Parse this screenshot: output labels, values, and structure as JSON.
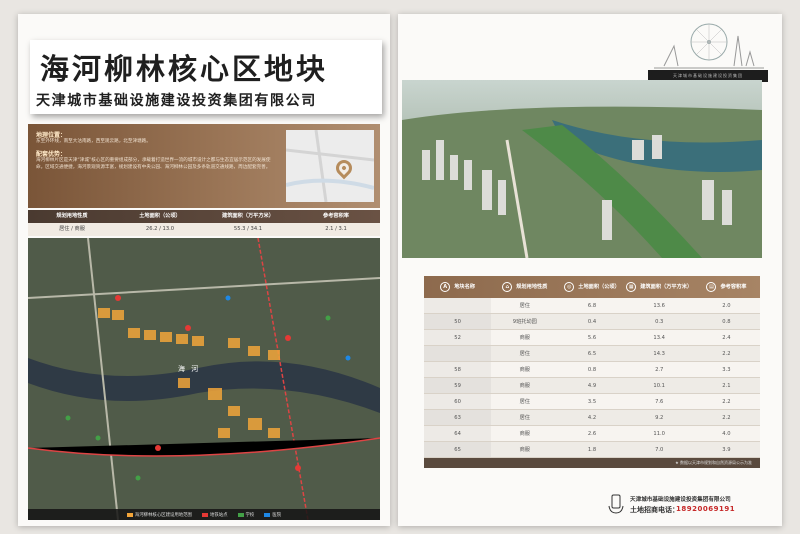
{
  "title": {
    "main": "海河柳林核心区地块",
    "sub": "天津城市基础设施建设投资集团有限公司"
  },
  "info": {
    "location_label": "地理位置：",
    "location_text": "东至外环线，南至大沽南路，西至观云路，北至津塘路。",
    "advantage_label": "配套优势：",
    "advantage_text": "海河柳林片区是天津“津城”核心区的重要组成部分，承载着打造世界一流的城市设计之都与生态宜居示范区的发展使命。区域交通便捷，海河景观资源丰富，规划建设有中央公园、海河柳林公园及多条轨道交通线路，周边配套完善。",
    "accent_color": "#8a6446"
  },
  "stats": {
    "headers": [
      "规划用地性质",
      "土地面积（公顷）",
      "建筑面积（万平方米）",
      "参考容积率"
    ],
    "values": [
      "居住 / 商服",
      "26.2 / 13.0",
      "55.3 / 34.1",
      "2.1 / 3.1"
    ]
  },
  "map": {
    "river_label": "海 河",
    "legend": [
      {
        "label": "海河柳林核心区建设用地范围",
        "color": "#f2a53a"
      },
      {
        "label": "地铁站点",
        "color": "#e53935"
      },
      {
        "label": "学校",
        "color": "#43a047"
      },
      {
        "label": "医院",
        "color": "#1e88e5"
      }
    ]
  },
  "city_banner": "天津城市基础设施建设投资集团",
  "plot_table": {
    "headers": [
      {
        "icon": "A",
        "label": "地块名称"
      },
      {
        "icon": "⌂",
        "label": "规划用地性质"
      },
      {
        "icon": "◎",
        "label": "土地面积（公顷）"
      },
      {
        "icon": "▦",
        "label": "建筑面积（万平方米）"
      },
      {
        "icon": "▤",
        "label": "参考容积率"
      }
    ],
    "rows": [
      {
        "name": "",
        "use": "居住",
        "land": "6.8",
        "build": "13.6",
        "far": "2.0"
      },
      {
        "name": "50",
        "use": "9班托幼园",
        "land": "0.4",
        "build": "0.3",
        "far": "0.8"
      },
      {
        "name": "52",
        "use": "商服",
        "land": "5.6",
        "build": "13.4",
        "far": "2.4"
      },
      {
        "name": "",
        "use": "居住",
        "land": "6.5",
        "build": "14.3",
        "far": "2.2"
      },
      {
        "name": "58",
        "use": "商服",
        "land": "0.8",
        "build": "2.7",
        "far": "3.3"
      },
      {
        "name": "59",
        "use": "商服",
        "land": "4.9",
        "build": "10.1",
        "far": "2.1"
      },
      {
        "name": "60",
        "use": "居住",
        "land": "3.5",
        "build": "7.6",
        "far": "2.2"
      },
      {
        "name": "63",
        "use": "居住",
        "land": "4.2",
        "build": "9.2",
        "far": "2.2"
      },
      {
        "name": "64",
        "use": "商服",
        "land": "2.6",
        "build": "11.0",
        "far": "4.0"
      },
      {
        "name": "65",
        "use": "商服",
        "land": "1.8",
        "build": "7.0",
        "build_note": "",
        "far": "3.9"
      }
    ],
    "note": "★ 数据以天津市规划和自然资源局公示为准"
  },
  "contact": {
    "org": "天津城市基础设施建设投资集团有限公司",
    "tel_label": "土地招商电话：",
    "tel": "18920069191"
  }
}
